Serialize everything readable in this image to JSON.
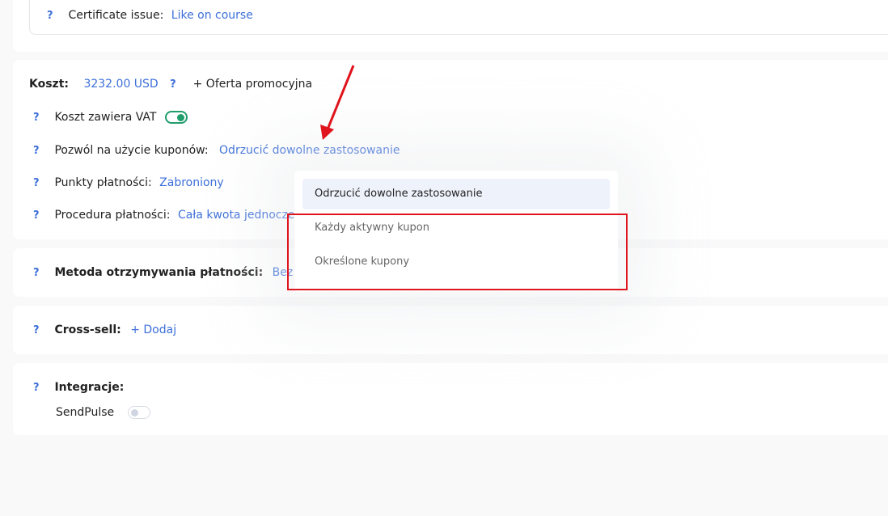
{
  "certificate": {
    "label": "Certificate issue:",
    "value": "Like on course"
  },
  "cost": {
    "label": "Koszt:",
    "amount": "3232.00 USD",
    "promo_button": "+ Oferta promocyjna",
    "vat_label": "Koszt zawiera VAT",
    "vat_enabled": true,
    "coupon_label": "Pozwól na użycie kuponów:",
    "coupon_value": "Odrzucić dowolne zastosowanie",
    "points_label": "Punkty płatności:",
    "points_value": "Zabroniony",
    "procedure_label": "Procedura płatności:",
    "procedure_value": "Cała kwota jednocześni"
  },
  "payment_method": {
    "label": "Metoda otrzymywania płatności:",
    "value": "Bez syst"
  },
  "cross_sell": {
    "label": "Cross-sell:",
    "add": "+ Dodaj"
  },
  "integrations": {
    "label": "Integracje:",
    "sendpulse_label": "SendPulse",
    "sendpulse_enabled": false
  },
  "help_glyph": "?",
  "coupon_dropdown": {
    "options": [
      "Odrzucić dowolne zastosowanie",
      "Każdy aktywny kupon",
      "Określone kupony"
    ],
    "selected": "Odrzucić dowolne zastosowanie"
  },
  "colors": {
    "link": "#3d6fd8",
    "toggle_on": "#1f9d6b",
    "annotation": "#e0141c"
  }
}
